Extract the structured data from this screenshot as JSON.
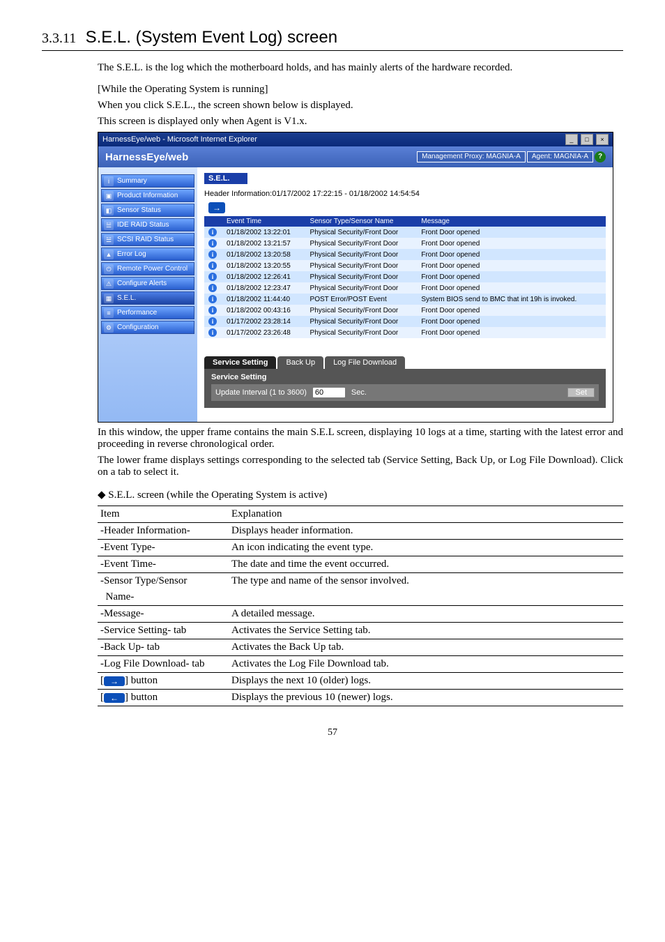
{
  "doc": {
    "heading_num": "3.3.11",
    "heading_title": "S.E.L. (System Event Log) screen",
    "intro": "The S.E.L. is the log which the motherboard holds, and has mainly alerts of the hardware recorded.",
    "note1": "[While the Operating System is running]",
    "note2": "When you click S.E.L., the screen shown below is displayed.",
    "note3": "This screen is displayed only when Agent is V1.x.",
    "after1": "In this window, the upper frame contains the main S.E.L screen, displaying 10 logs at a time, starting with the latest error and proceeding in reverse chronological order.",
    "after2": "The lower frame displays settings corresponding to the selected tab (Service Setting, Back Up, or Log File Download).   Click on a tab to select it.",
    "table_heading": "◆ S.E.L. screen (while the Operating System is active)",
    "page_no": "57"
  },
  "window": {
    "title": "HarnessEye/web - Microsoft Internet Explorer",
    "brand": "HarnessEye/web",
    "proxy_label": "Management Proxy: MAGNIA-A",
    "agent_label": "Agent: MAGNIA-A",
    "help": "?"
  },
  "sidebar": {
    "items": [
      {
        "label": "Summary"
      },
      {
        "label": "Product Information"
      },
      {
        "label": "Sensor Status"
      },
      {
        "label": "IDE RAID Status"
      },
      {
        "label": "SCSI RAID Status"
      },
      {
        "label": "Error Log"
      },
      {
        "label": "Remote Power Control"
      },
      {
        "label": "Configure Alerts"
      },
      {
        "label": "S.E.L."
      },
      {
        "label": "Performance"
      },
      {
        "label": "Configuration"
      }
    ]
  },
  "sel": {
    "panel_title": "S.E.L.",
    "header_line": "Header Information:01/17/2002 17:22:15 - 01/18/2002 14:54:54",
    "columns": {
      "c1": "Event Time",
      "c2": "Sensor Type/Sensor Name",
      "c3": "Message"
    },
    "rows": [
      {
        "t": "01/18/2002 13:22:01",
        "s": "Physical Security/Front Door",
        "m": "Front Door opened"
      },
      {
        "t": "01/18/2002 13:21:57",
        "s": "Physical Security/Front Door",
        "m": "Front Door opened"
      },
      {
        "t": "01/18/2002 13:20:58",
        "s": "Physical Security/Front Door",
        "m": "Front Door opened"
      },
      {
        "t": "01/18/2002 13:20:55",
        "s": "Physical Security/Front Door",
        "m": "Front Door opened"
      },
      {
        "t": "01/18/2002 12:26:41",
        "s": "Physical Security/Front Door",
        "m": "Front Door opened"
      },
      {
        "t": "01/18/2002 12:23:47",
        "s": "Physical Security/Front Door",
        "m": "Front Door opened"
      },
      {
        "t": "01/18/2002 11:44:40",
        "s": "POST Error/POST Event",
        "m": "System BIOS send to BMC that int 19h is invoked."
      },
      {
        "t": "01/18/2002 00:43:16",
        "s": "Physical Security/Front Door",
        "m": "Front Door opened"
      },
      {
        "t": "01/17/2002 23:28:14",
        "s": "Physical Security/Front Door",
        "m": "Front Door opened"
      },
      {
        "t": "01/17/2002 23:26:48",
        "s": "Physical Security/Front Door",
        "m": "Front Door opened"
      }
    ],
    "tabs": {
      "t1": "Service Setting",
      "t2": "Back Up",
      "t3": "Log File Download"
    },
    "svc_label": "Service Setting",
    "interval_label": "Update Interval (1 to 3600)",
    "interval_value": "60",
    "sec_label": "Sec.",
    "set_label": "Set"
  },
  "exp": {
    "h1": "Item",
    "h2": "Explanation",
    "rows": [
      {
        "i": "-Header Information-",
        "e": "Displays header information."
      },
      {
        "i": "-Event Type-",
        "e": "An icon indicating the event type."
      },
      {
        "i": "-Event Time-",
        "e": "The date and time the event occurred."
      },
      {
        "i": "-Sensor Type/Sensor",
        "e": "The type and name of the sensor involved."
      },
      {
        "i": "  Name-",
        "e": ""
      },
      {
        "i": "-Message-",
        "e": "A detailed message."
      },
      {
        "i": "-Service Setting- tab",
        "e": "Activates the Service Setting tab."
      },
      {
        "i": "-Back Up- tab",
        "e": "Activates the Back Up tab."
      },
      {
        "i": "-Log File Download- tab",
        "e": "Activates the Log File Download tab."
      },
      {
        "i": "[→] button",
        "e": "Displays the next 10 (older) logs."
      },
      {
        "i": "[←] button",
        "e": "Displays the previous 10 (newer) logs."
      }
    ]
  }
}
